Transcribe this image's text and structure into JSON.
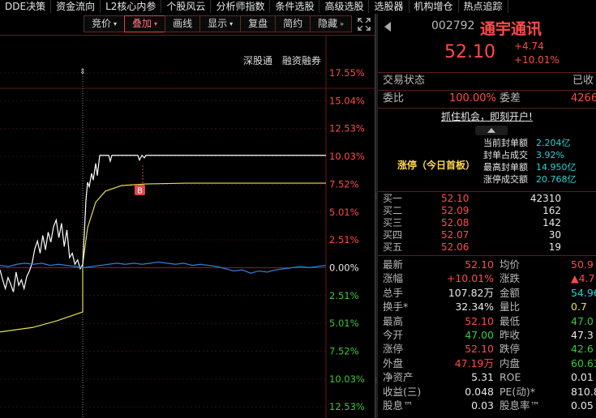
{
  "menu": [
    "DDE决策",
    "资金流向",
    "L2核心内参",
    "个股风云",
    "分析师指数",
    "条件选股",
    "高级选股",
    "选股器",
    "机构增仓",
    "热点追踪"
  ],
  "toolbar": {
    "items": [
      {
        "label": "竞价",
        "caret": "▾",
        "active": false
      },
      {
        "label": "叠加",
        "caret": "▾",
        "active": true
      },
      {
        "label": "画线",
        "caret": "",
        "active": false
      },
      {
        "label": "显示",
        "caret": "▾",
        "active": false
      },
      {
        "label": "复盘",
        "caret": "",
        "active": false
      },
      {
        "label": "简约",
        "caret": "",
        "active": false
      },
      {
        "label": "隐藏",
        "caret": "»",
        "active": false
      }
    ],
    "fullscreen_icon": "fullscreen-icon"
  },
  "chart": {
    "tags": [
      "深股通",
      "融资融券"
    ],
    "marker_label": "B",
    "axis_right": [
      {
        "text": "17.55%",
        "color": "#ff4a4a"
      },
      {
        "text": "15.04%",
        "color": "#ff4a4a"
      },
      {
        "text": "12.53%",
        "color": "#ff4a4a"
      },
      {
        "text": "10.03%",
        "color": "#ff4a4a"
      },
      {
        "text": "7.52%",
        "color": "#ff4a4a"
      },
      {
        "text": "5.01%",
        "color": "#ff4a4a"
      },
      {
        "text": "2.51%",
        "color": "#ff4a4a"
      },
      {
        "text": "0.00%",
        "color": "#e8e8e8"
      },
      {
        "text": "2.51%",
        "color": "#3ec83e"
      },
      {
        "text": "5.01%",
        "color": "#3ec83e"
      },
      {
        "text": "7.52%",
        "color": "#3ec83e"
      },
      {
        "text": "10.03%",
        "color": "#3ec83e"
      },
      {
        "text": "12.53%",
        "color": "#3ec83e"
      }
    ]
  },
  "stock": {
    "code": "002792",
    "name": "通宇通讯",
    "price": "52.10",
    "change": "+4.74",
    "change_pct": "+10.01%",
    "status_label": "交易状态",
    "status_value": "已收",
    "weibi_label": "委比",
    "weibi_value": "100.00%",
    "weicha_label": "委差",
    "weicha_value": "4266",
    "promo": "抓住机会，即刻开户!"
  },
  "limitup": {
    "title": "涨停（今日首板）",
    "rows": [
      {
        "label": "当前封单额",
        "value": "2.204亿"
      },
      {
        "label": "封单占成交",
        "value": "3.92%"
      },
      {
        "label": "最高封单额",
        "value": "14.950亿"
      },
      {
        "label": "涨停成交额",
        "value": "20.768亿"
      }
    ]
  },
  "orderbook": [
    {
      "label": "买一",
      "price": "52.10",
      "vol": "42310"
    },
    {
      "label": "买二",
      "price": "52.09",
      "vol": "162"
    },
    {
      "label": "买三",
      "price": "52.08",
      "vol": "142"
    },
    {
      "label": "买四",
      "price": "52.07",
      "vol": "30"
    },
    {
      "label": "买五",
      "price": "52.06",
      "vol": "19"
    }
  ],
  "quotes": [
    {
      "l1": "最新",
      "v1": "52.10",
      "c1": "red",
      "l2": "均价",
      "v2": "50.9",
      "c2": "red"
    },
    {
      "l1": "涨幅",
      "v1": "+10.01%",
      "c1": "red",
      "l2": "涨跌",
      "v2": "▲4.7",
      "c2": "red"
    },
    {
      "l1": "总手",
      "v1": "107.82万",
      "c1": "white",
      "l2": "金额",
      "v2": "54.96",
      "c2": "cyan"
    },
    {
      "l1": "换手*",
      "v1": "32.34%",
      "c1": "white",
      "l2": "量比",
      "v2": "0.7",
      "c2": "yellow"
    },
    {
      "l1": "最高",
      "v1": "52.10",
      "c1": "red",
      "l2": "最低",
      "v2": "47.0",
      "c2": "green"
    },
    {
      "l1": "今开",
      "v1": "47.00",
      "c1": "green",
      "l2": "昨收",
      "v2": "47.3",
      "c2": "white"
    },
    {
      "l1": "涨停",
      "v1": "52.10",
      "c1": "red",
      "l2": "跌停",
      "v2": "42.6",
      "c2": "green"
    },
    {
      "l1": "外盘",
      "v1": "47.19万",
      "c1": "red",
      "l2": "内盘",
      "v2": "60.63",
      "c2": "green"
    },
    {
      "l1": "净资产",
      "v1": "5.31",
      "c1": "white",
      "l2": "ROE",
      "v2": "0.01",
      "c2": "white"
    },
    {
      "l1": "收益(三)",
      "v1": "0.048",
      "c1": "white",
      "l2": "PE(动)*",
      "v2": "810.8",
      "c2": "white"
    },
    {
      "l1": "股息™",
      "v1": "0.03",
      "c1": "white",
      "l2": "股息率™",
      "v2": "0.05",
      "c2": "white"
    }
  ]
}
